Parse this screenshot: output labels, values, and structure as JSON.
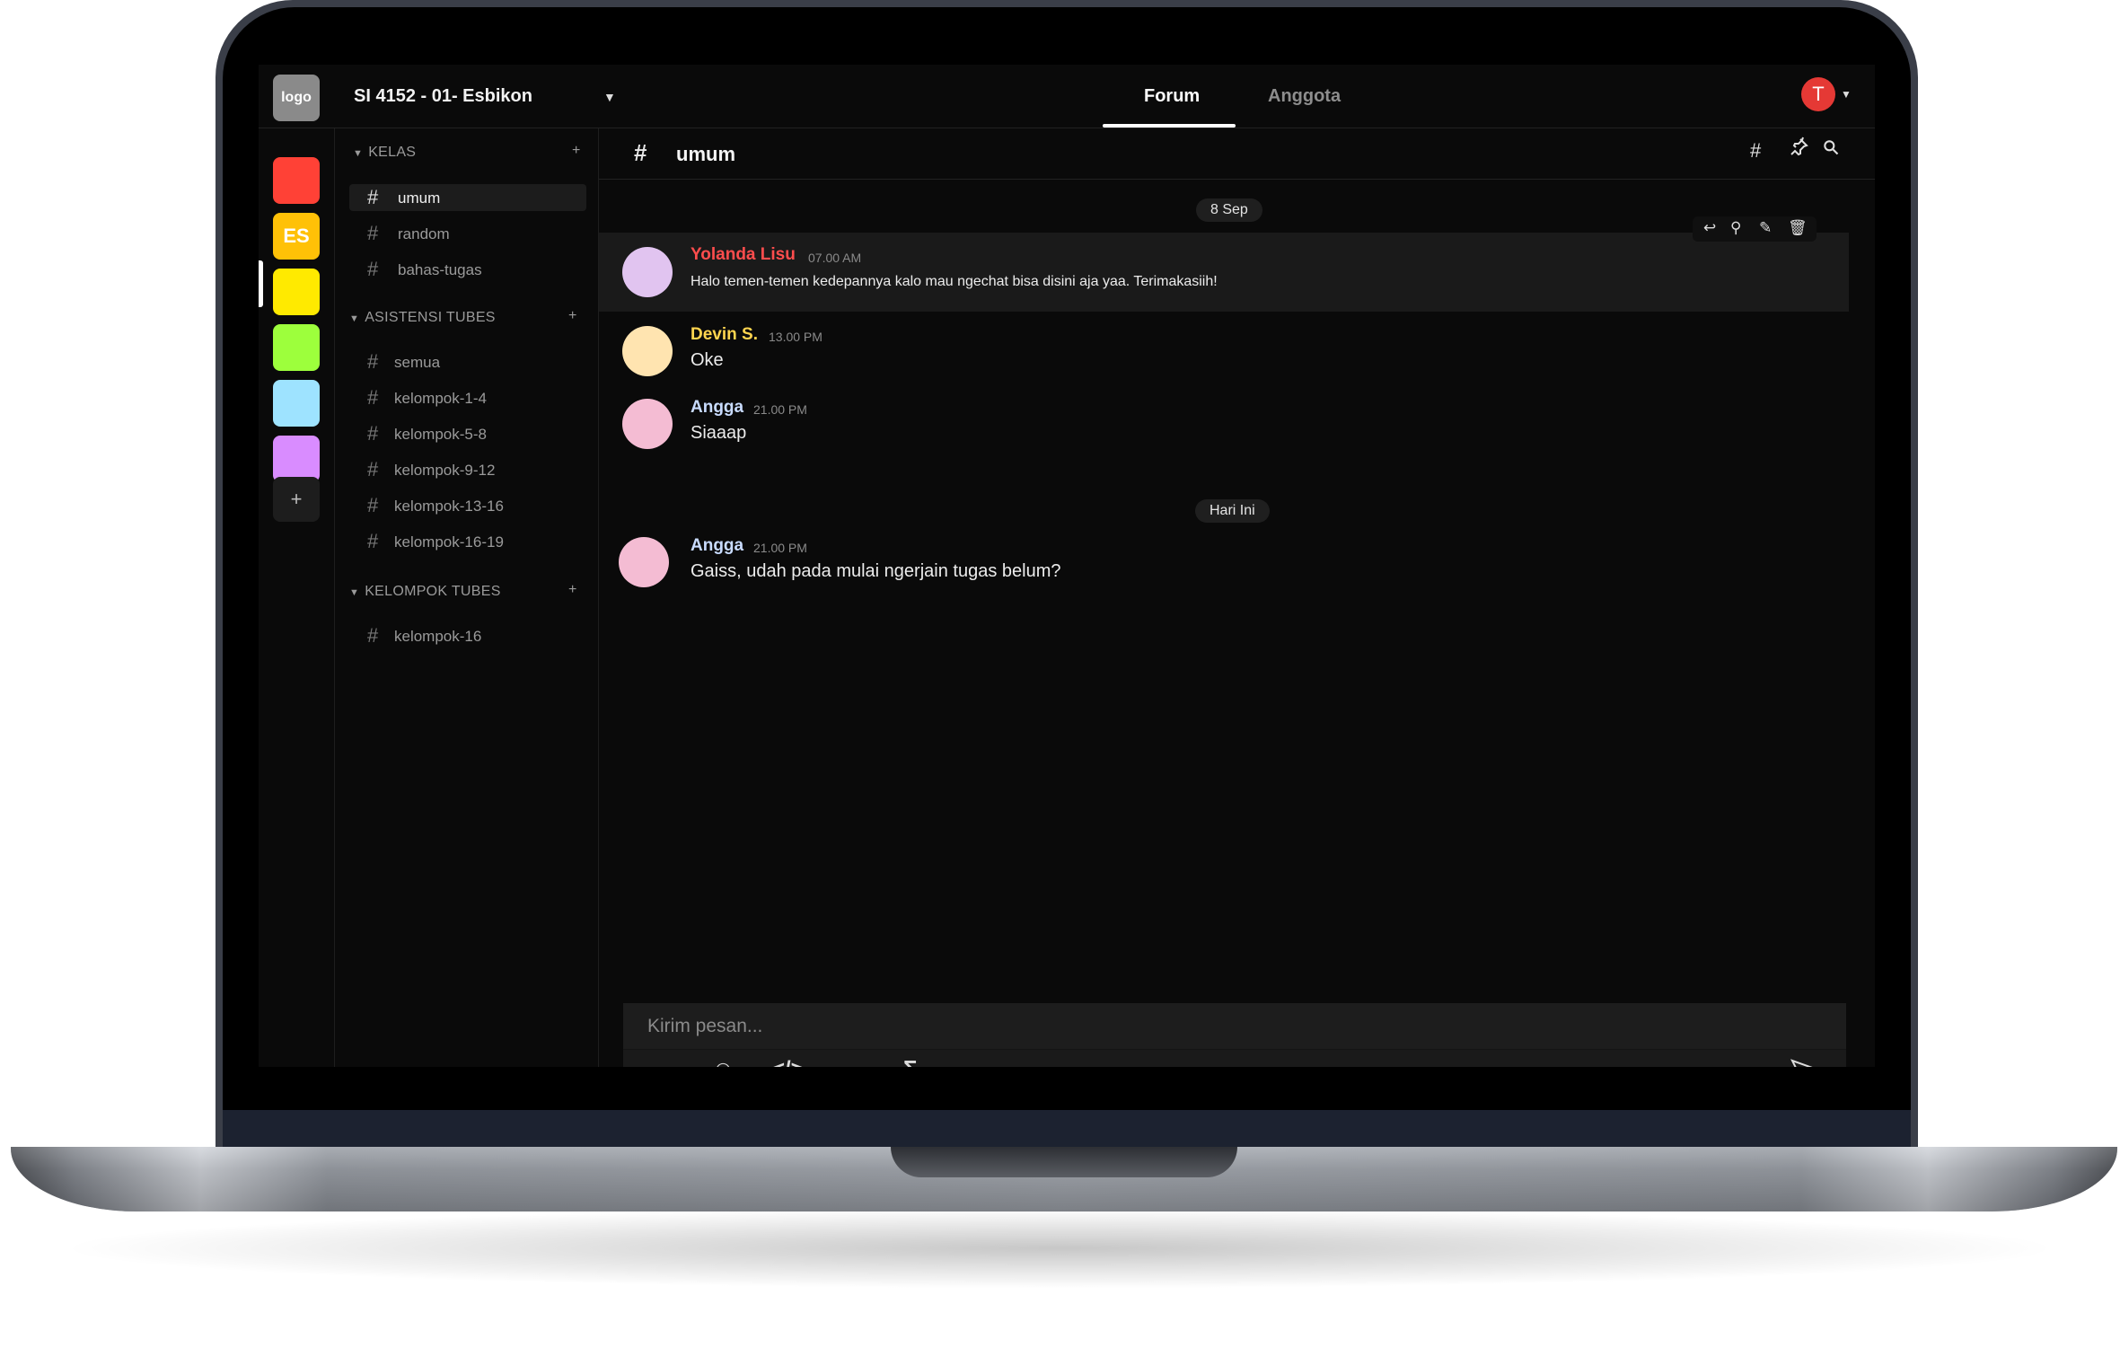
{
  "header": {
    "logo": "logo",
    "class_name": "SI 4152 - 01- Esbikon",
    "dropdown_icon": "caret-down-icon",
    "tabs": [
      {
        "label": "Forum",
        "active": true
      },
      {
        "label": "Anggota",
        "active": false
      }
    ],
    "user_initial": "T",
    "user_color": "#e53935"
  },
  "rail": {
    "items": [
      {
        "label": "",
        "color": "#ff4136"
      },
      {
        "label": "ES",
        "color": "#ffc107",
        "active": true
      },
      {
        "label": "",
        "color": "#ffea00"
      },
      {
        "label": "",
        "color": "#9dff3c"
      },
      {
        "label": "",
        "color": "#9ee3ff"
      },
      {
        "label": "",
        "color": "#d98cff"
      }
    ],
    "add_label": "+"
  },
  "sidebar": {
    "categories": [
      {
        "title": "KELAS",
        "add": "+",
        "channels": [
          "umum",
          "random",
          "bahas-tugas"
        ]
      },
      {
        "title": "ASISTENSI TUBES",
        "add": "+",
        "channels": [
          "semua",
          "kelompok-1-4",
          "kelompok-5-8",
          "kelompok-9-12",
          "kelompok-13-16",
          "kelompok-16-19"
        ]
      },
      {
        "title": "KELOMPOK TUBES",
        "add": "+",
        "channels": [
          "kelompok-16"
        ]
      }
    ],
    "active_channel": "umum"
  },
  "channel": {
    "hash": "#",
    "title": "umum",
    "icons": [
      "hash-icon",
      "pin-icon",
      "search-icon"
    ]
  },
  "messages": {
    "date1": "8 Sep",
    "date2": "Hari Ini",
    "items": [
      {
        "author": "Yolanda Lisu",
        "time": "07.00 AM",
        "text": "Halo temen-temen kedepannya kalo mau ngechat bisa disini aja yaa. Terimakasiih!",
        "author_color": "#ff4d4d",
        "avatar_color": "#e1c4f0"
      },
      {
        "author": "Devin S.",
        "time": "13.00 PM",
        "text": "Oke",
        "author_color": "#ffd54f",
        "avatar_color": "#ffe4b0"
      },
      {
        "author": "Angga",
        "time": "21.00 PM",
        "text": "Siaaap",
        "author_color": "#c9dcff",
        "avatar_color": "#f4bcd3"
      },
      {
        "author": "Angga",
        "time": "21.00 PM",
        "text": "Gaiss, udah pada mulai ngerjain tugas belum?",
        "author_color": "#c9dcff",
        "avatar_color": "#f4bcd3"
      }
    ],
    "hover_actions": [
      "reply-icon",
      "pin-icon",
      "edit-icon",
      "delete-icon"
    ]
  },
  "composer": {
    "placeholder": "Kirim pesan...",
    "tools": [
      "emoji-icon",
      "code-icon",
      "sigma-icon"
    ],
    "send": "send-icon"
  }
}
